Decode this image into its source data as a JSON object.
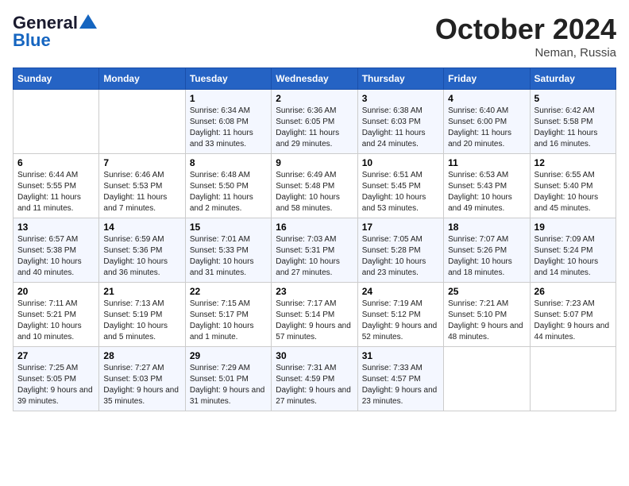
{
  "header": {
    "logo_line1": "General",
    "logo_line2": "Blue",
    "month": "October 2024",
    "location": "Neman, Russia"
  },
  "days_of_week": [
    "Sunday",
    "Monday",
    "Tuesday",
    "Wednesday",
    "Thursday",
    "Friday",
    "Saturday"
  ],
  "weeks": [
    [
      {
        "day": "",
        "info": ""
      },
      {
        "day": "",
        "info": ""
      },
      {
        "day": "1",
        "info": "Sunrise: 6:34 AM\nSunset: 6:08 PM\nDaylight: 11 hours and 33 minutes."
      },
      {
        "day": "2",
        "info": "Sunrise: 6:36 AM\nSunset: 6:05 PM\nDaylight: 11 hours and 29 minutes."
      },
      {
        "day": "3",
        "info": "Sunrise: 6:38 AM\nSunset: 6:03 PM\nDaylight: 11 hours and 24 minutes."
      },
      {
        "day": "4",
        "info": "Sunrise: 6:40 AM\nSunset: 6:00 PM\nDaylight: 11 hours and 20 minutes."
      },
      {
        "day": "5",
        "info": "Sunrise: 6:42 AM\nSunset: 5:58 PM\nDaylight: 11 hours and 16 minutes."
      }
    ],
    [
      {
        "day": "6",
        "info": "Sunrise: 6:44 AM\nSunset: 5:55 PM\nDaylight: 11 hours and 11 minutes."
      },
      {
        "day": "7",
        "info": "Sunrise: 6:46 AM\nSunset: 5:53 PM\nDaylight: 11 hours and 7 minutes."
      },
      {
        "day": "8",
        "info": "Sunrise: 6:48 AM\nSunset: 5:50 PM\nDaylight: 11 hours and 2 minutes."
      },
      {
        "day": "9",
        "info": "Sunrise: 6:49 AM\nSunset: 5:48 PM\nDaylight: 10 hours and 58 minutes."
      },
      {
        "day": "10",
        "info": "Sunrise: 6:51 AM\nSunset: 5:45 PM\nDaylight: 10 hours and 53 minutes."
      },
      {
        "day": "11",
        "info": "Sunrise: 6:53 AM\nSunset: 5:43 PM\nDaylight: 10 hours and 49 minutes."
      },
      {
        "day": "12",
        "info": "Sunrise: 6:55 AM\nSunset: 5:40 PM\nDaylight: 10 hours and 45 minutes."
      }
    ],
    [
      {
        "day": "13",
        "info": "Sunrise: 6:57 AM\nSunset: 5:38 PM\nDaylight: 10 hours and 40 minutes."
      },
      {
        "day": "14",
        "info": "Sunrise: 6:59 AM\nSunset: 5:36 PM\nDaylight: 10 hours and 36 minutes."
      },
      {
        "day": "15",
        "info": "Sunrise: 7:01 AM\nSunset: 5:33 PM\nDaylight: 10 hours and 31 minutes."
      },
      {
        "day": "16",
        "info": "Sunrise: 7:03 AM\nSunset: 5:31 PM\nDaylight: 10 hours and 27 minutes."
      },
      {
        "day": "17",
        "info": "Sunrise: 7:05 AM\nSunset: 5:28 PM\nDaylight: 10 hours and 23 minutes."
      },
      {
        "day": "18",
        "info": "Sunrise: 7:07 AM\nSunset: 5:26 PM\nDaylight: 10 hours and 18 minutes."
      },
      {
        "day": "19",
        "info": "Sunrise: 7:09 AM\nSunset: 5:24 PM\nDaylight: 10 hours and 14 minutes."
      }
    ],
    [
      {
        "day": "20",
        "info": "Sunrise: 7:11 AM\nSunset: 5:21 PM\nDaylight: 10 hours and 10 minutes."
      },
      {
        "day": "21",
        "info": "Sunrise: 7:13 AM\nSunset: 5:19 PM\nDaylight: 10 hours and 5 minutes."
      },
      {
        "day": "22",
        "info": "Sunrise: 7:15 AM\nSunset: 5:17 PM\nDaylight: 10 hours and 1 minute."
      },
      {
        "day": "23",
        "info": "Sunrise: 7:17 AM\nSunset: 5:14 PM\nDaylight: 9 hours and 57 minutes."
      },
      {
        "day": "24",
        "info": "Sunrise: 7:19 AM\nSunset: 5:12 PM\nDaylight: 9 hours and 52 minutes."
      },
      {
        "day": "25",
        "info": "Sunrise: 7:21 AM\nSunset: 5:10 PM\nDaylight: 9 hours and 48 minutes."
      },
      {
        "day": "26",
        "info": "Sunrise: 7:23 AM\nSunset: 5:07 PM\nDaylight: 9 hours and 44 minutes."
      }
    ],
    [
      {
        "day": "27",
        "info": "Sunrise: 7:25 AM\nSunset: 5:05 PM\nDaylight: 9 hours and 39 minutes."
      },
      {
        "day": "28",
        "info": "Sunrise: 7:27 AM\nSunset: 5:03 PM\nDaylight: 9 hours and 35 minutes."
      },
      {
        "day": "29",
        "info": "Sunrise: 7:29 AM\nSunset: 5:01 PM\nDaylight: 9 hours and 31 minutes."
      },
      {
        "day": "30",
        "info": "Sunrise: 7:31 AM\nSunset: 4:59 PM\nDaylight: 9 hours and 27 minutes."
      },
      {
        "day": "31",
        "info": "Sunrise: 7:33 AM\nSunset: 4:57 PM\nDaylight: 9 hours and 23 minutes."
      },
      {
        "day": "",
        "info": ""
      },
      {
        "day": "",
        "info": ""
      }
    ]
  ]
}
